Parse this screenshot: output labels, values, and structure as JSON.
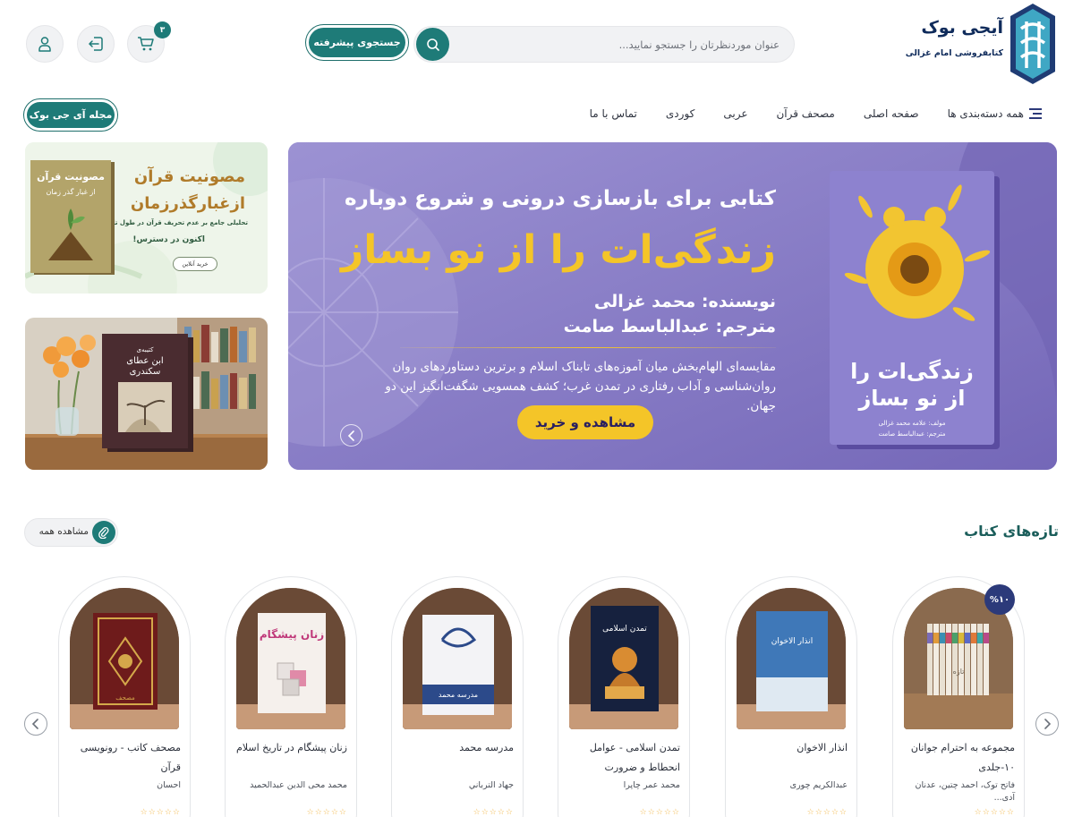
{
  "header": {
    "logo_title": "آیجی بوک",
    "logo_subtitle": "کتابفروشی امام غزالی",
    "search_placeholder": "عنوان موردنظرتان را جستجو نمایید...",
    "advanced_search_label": "جستجوی پیشرفته",
    "cart_count": "۳"
  },
  "nav": {
    "items": [
      {
        "label": "همه دسته‌بندی ها"
      },
      {
        "label": "صفحه اصلی"
      },
      {
        "label": "مصحف قرآن"
      },
      {
        "label": "عربی"
      },
      {
        "label": "کوردی"
      },
      {
        "label": "تماس با ما"
      }
    ],
    "magazine_label": "مجله آی جی بوک"
  },
  "hero": {
    "line1": "کتابی برای بازسازی درونی و شروع دوباره",
    "line2": "زندگی‌ات را از نو بساز",
    "author": "نویسنده: محمد غزالی",
    "translator": "مترجم: عبدالباسط صامت",
    "description": "مقایسه‌ای الهام‌بخش میان آموزه‌های تابناک اسلام و برترین دستاوردهای روان روان‌شناسی و آداب رفتاری در تمدن غرب؛ کشف همسویی شگفت‌انگیز این دو جهان.",
    "cta": "مشاهده و خرید",
    "book_title_line1": "زندگی‌ات را",
    "book_title_line2": "از نو بساز",
    "book_author": "مولف: علامه محمد غزالی",
    "book_translator": "مترجم: عبدالباسط صامت"
  },
  "side_banner_1": {
    "title_line1": "مصونیت قرآن",
    "title_line2": "ازغبارگذرزمان",
    "subtitle": "تحلیلی جامع بر عدم تحریف قرآن در طول تاریخ",
    "available": "اکنون در دسترس!",
    "button": "خرید آنلاین",
    "book_title_line1": "مصونیت قرآن",
    "book_title_line2": "از غبار گذر زمان"
  },
  "side_banner_2": {
    "book_title_line1": "کتیبه‌ی",
    "book_title_line2": "ابن عطای",
    "book_title_line3": "سکندری"
  },
  "section": {
    "title": "تازه‌های کتاب",
    "see_all": "مشاهده همه"
  },
  "products": [
    {
      "title": "مجموعه به احترام جوانان ۱۰-جلدی",
      "author": "فاتح توک، احمد چتین، عدنان آدی...",
      "discount": "%۱۰",
      "cover": "تازه"
    },
    {
      "title": "انذار الاخوان",
      "author": "عبدالکریم چوری",
      "cover": "انذار الاخوان"
    },
    {
      "title": "تمدن اسلامی - عوامل انحطاط و ضرورت",
      "author": "محمد عمر چاپرا",
      "cover": "تمدن اسلامی"
    },
    {
      "title": "مدرسه محمد",
      "author": "جهاد الترباني",
      "cover": "مدرسه محمد"
    },
    {
      "title": "زنان پیشگام در تاریخ اسلام",
      "author": "محمد محی الدین عبدالحمید",
      "cover": "زنان پیشگام"
    },
    {
      "title": "مصحف کاتب - رونویسی قرآن",
      "author": "احسان",
      "cover": "مصحف"
    }
  ],
  "stars": "☆☆☆☆☆",
  "colors": {
    "brand_teal": "#1e7b78",
    "navy": "#0f2b5b",
    "hero_purple": "#8579c4",
    "hero_yellow": "#f4c528"
  }
}
